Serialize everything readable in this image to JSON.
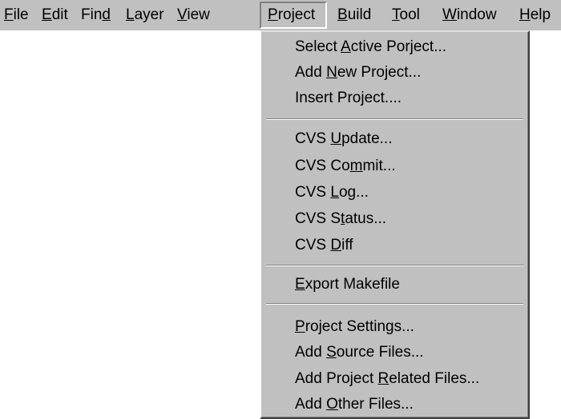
{
  "menubar": {
    "items": [
      {
        "pre": "",
        "key": "F",
        "post": "ile"
      },
      {
        "pre": "",
        "key": "E",
        "post": "dit"
      },
      {
        "pre": "Fin",
        "key": "d",
        "post": ""
      },
      {
        "pre": "",
        "key": "L",
        "post": "ayer"
      },
      {
        "pre": "",
        "key": "V",
        "post": "iew"
      },
      {
        "pre": "",
        "key": "P",
        "post": "roject"
      },
      {
        "pre": "",
        "key": "B",
        "post": "uild"
      },
      {
        "pre": "",
        "key": "T",
        "post": "ool"
      },
      {
        "pre": "",
        "key": "W",
        "post": "indow"
      },
      {
        "pre": "",
        "key": "H",
        "post": "elp"
      }
    ]
  },
  "project_menu": {
    "items": [
      {
        "pre": "Select ",
        "key": "A",
        "post": "ctive Porject..."
      },
      {
        "pre": "Add ",
        "key": "N",
        "post": "ew Project..."
      },
      {
        "pre": "Insert Project....",
        "key": "",
        "post": ""
      },
      {
        "pre": "CVS ",
        "key": "U",
        "post": "pdate..."
      },
      {
        "pre": "CVS Co",
        "key": "m",
        "post": "mit..."
      },
      {
        "pre": "CVS ",
        "key": "L",
        "post": "og..."
      },
      {
        "pre": "CVS S",
        "key": "t",
        "post": "atus..."
      },
      {
        "pre": "CVS ",
        "key": "D",
        "post": "iff"
      },
      {
        "pre": "",
        "key": "E",
        "post": "xport Makefile"
      },
      {
        "pre": "",
        "key": "P",
        "post": "roject Settings..."
      },
      {
        "pre": "Add ",
        "key": "S",
        "post": "ource Files..."
      },
      {
        "pre": "Add Project ",
        "key": "R",
        "post": "elated Files..."
      },
      {
        "pre": "Add ",
        "key": "O",
        "post": "ther Files..."
      }
    ]
  }
}
